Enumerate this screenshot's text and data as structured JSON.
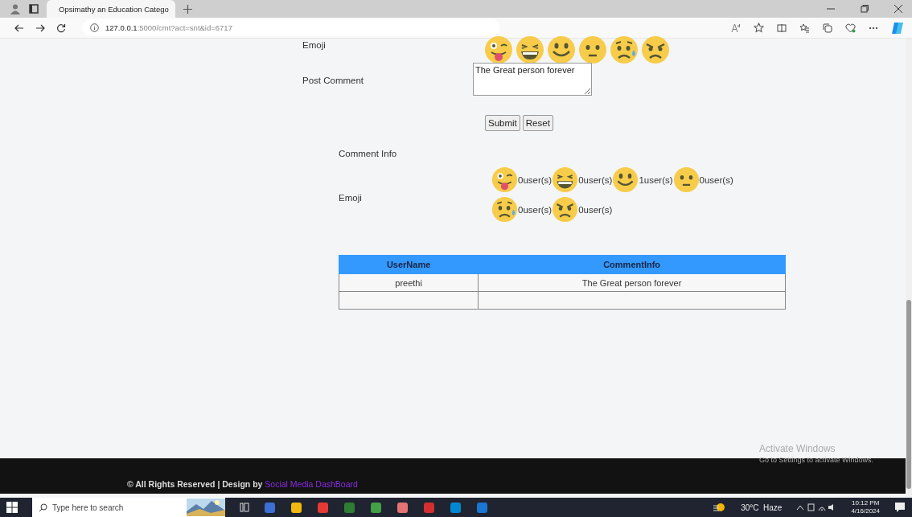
{
  "browser": {
    "tab_title": "Opsimathy an Education Catego",
    "url_host": "127.0.0.1",
    "url_rest": ":5000/cmt?act=snt&id=6717"
  },
  "form": {
    "emoji_label": "Emoji",
    "emojis": [
      {
        "kind": "tongue"
      },
      {
        "kind": "grin"
      },
      {
        "kind": "smile"
      },
      {
        "kind": "neutral"
      },
      {
        "kind": "sweat"
      },
      {
        "kind": "angry"
      }
    ],
    "comment_label": "Post Comment",
    "comment_value": "The Great person forever",
    "buttons": [
      "Submit",
      "Reset"
    ]
  },
  "comment_info": {
    "title": "Comment Info",
    "emoji_label": "Emoji",
    "counts": [
      {
        "kind": "tongue",
        "count": "0user(s)"
      },
      {
        "kind": "grin",
        "count": "0user(s)"
      },
      {
        "kind": "smile",
        "count": "1user(s)"
      },
      {
        "kind": "neutral",
        "count": "0user(s)"
      },
      {
        "kind": "sweat",
        "count": "0user(s)"
      },
      {
        "kind": "angry",
        "count": "0user(s)"
      }
    ]
  },
  "table": {
    "columns": [
      "UserName",
      "CommentInfo"
    ],
    "rows": [
      [
        "preethi",
        "The Great person forever"
      ]
    ]
  },
  "footer": {
    "text": "© All Rights Reserved | Design by",
    "link": "Social Media DashBoard"
  },
  "os_notice": {
    "title": "Activate Windows",
    "text": "Go to Settings to activate Windows."
  },
  "taskbar": {
    "search_placeholder": "Type here to search",
    "weather": "30°C  Haze",
    "time": "10:12 PM",
    "date": "4/16/2024"
  }
}
